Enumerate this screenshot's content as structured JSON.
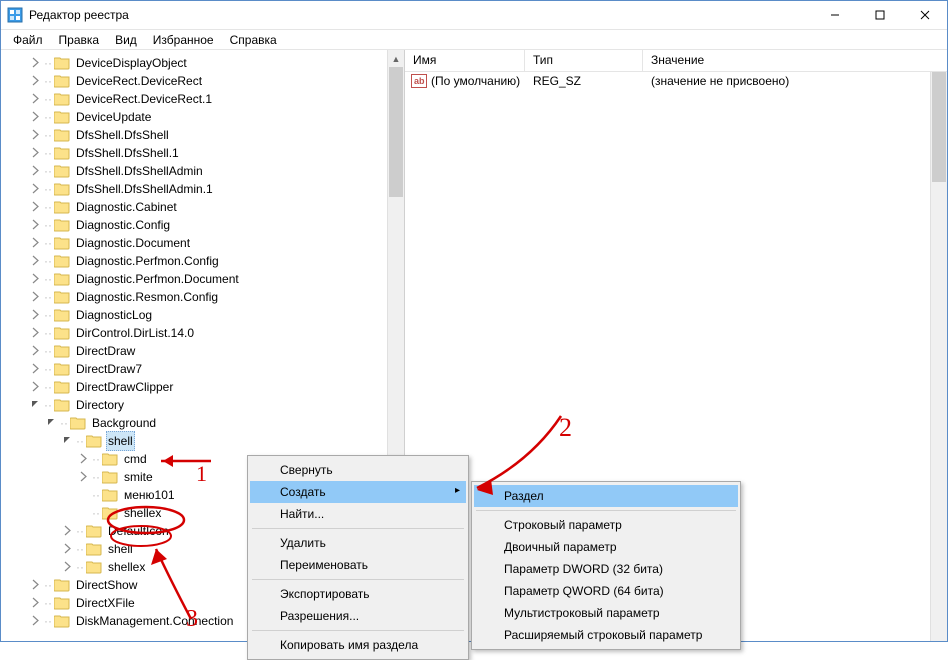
{
  "window": {
    "title": "Редактор реестра"
  },
  "menu": {
    "file": "Файл",
    "edit": "Правка",
    "view": "Вид",
    "favorites": "Избранное",
    "help": "Справка"
  },
  "tree": {
    "items": [
      "DeviceDisplayObject",
      "DeviceRect.DeviceRect",
      "DeviceRect.DeviceRect.1",
      "DeviceUpdate",
      "DfsShell.DfsShell",
      "DfsShell.DfsShell.1",
      "DfsShell.DfsShellAdmin",
      "DfsShell.DfsShellAdmin.1",
      "Diagnostic.Cabinet",
      "Diagnostic.Config",
      "Diagnostic.Document",
      "Diagnostic.Perfmon.Config",
      "Diagnostic.Perfmon.Document",
      "Diagnostic.Resmon.Config",
      "DiagnosticLog",
      "DirControl.DirList.14.0",
      "DirectDraw",
      "DirectDraw7",
      "DirectDrawClipper"
    ],
    "directory": "Directory",
    "background": "Background",
    "shell": "shell",
    "shell_children": [
      "cmd",
      "smite",
      "меню101",
      "shellex"
    ],
    "background_siblings": [
      "DefaultIcon",
      "shell",
      "shellex"
    ],
    "after": [
      "DirectShow",
      "DirectXFile",
      "DiskManagement.Connection"
    ]
  },
  "list": {
    "col_name": "Имя",
    "col_type": "Тип",
    "col_value": "Значение",
    "row0_name": "(По умолчанию)",
    "row0_type": "REG_SZ",
    "row0_value": "(значение не присвоено)"
  },
  "context1": {
    "collapse": "Свернуть",
    "new": "Создать",
    "find": "Найти...",
    "delete": "Удалить",
    "rename": "Переименовать",
    "export": "Экспортировать",
    "permissions": "Разрешения...",
    "copy_key_name": "Копировать имя раздела"
  },
  "context2": {
    "key": "Раздел",
    "string": "Строковый параметр",
    "binary": "Двоичный параметр",
    "dword": "Параметр DWORD (32 бита)",
    "qword": "Параметр QWORD (64 бита)",
    "multistring": "Мультистроковый параметр",
    "expstring": "Расширяемый строковый параметр"
  },
  "annotations": {
    "n1": "1",
    "n2": "2",
    "n3": "3"
  }
}
